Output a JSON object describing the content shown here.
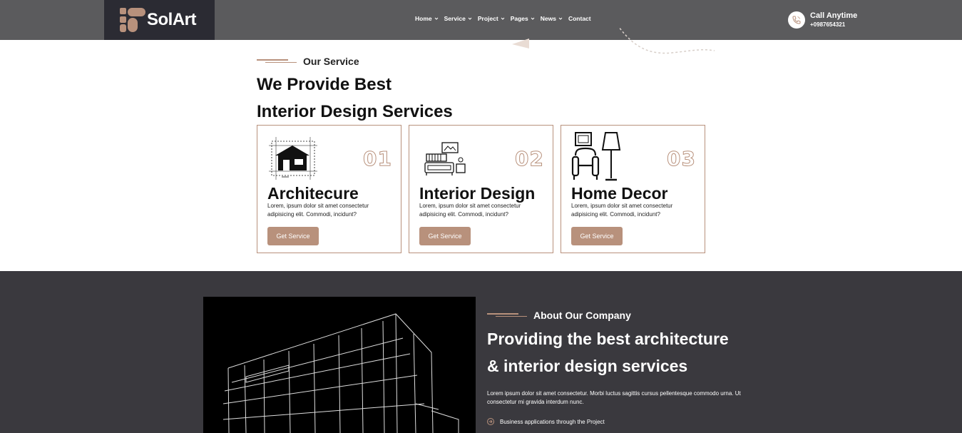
{
  "brand": {
    "name": "SolArt",
    "accent": "#b8917c",
    "header_bg": "#5b5b5d",
    "logo_bg": "#2b2b33"
  },
  "nav": {
    "items": [
      {
        "label": "Home",
        "has_dropdown": true
      },
      {
        "label": "Service",
        "has_dropdown": true
      },
      {
        "label": "Project",
        "has_dropdown": true
      },
      {
        "label": "Pages",
        "has_dropdown": true
      },
      {
        "label": "News",
        "has_dropdown": true
      },
      {
        "label": "Contact",
        "has_dropdown": false
      }
    ]
  },
  "call": {
    "label": "Call Anytime",
    "number": "+0987654321",
    "icon": "phone-icon"
  },
  "services": {
    "tag": "Our Service",
    "title_line1": "We Provide Best",
    "title_line2": "Interior Design Services",
    "cards": [
      {
        "number": "01",
        "title": "Architecure",
        "desc": "Lorem, ipsum dolor sit amet consectetur adipisicing elit. Commodi, incidunt?",
        "button": "Get Service",
        "icon": "house-blueprint-icon"
      },
      {
        "number": "02",
        "title": "Interior Design",
        "desc": "Lorem, ipsum dolor sit amet consectetur adipisicing elit. Commodi, incidunt?",
        "button": "Get Service",
        "icon": "living-room-icon"
      },
      {
        "number": "03",
        "title": "Home Decor",
        "desc": "Lorem, ipsum dolor sit amet consectetur adipisicing elit. Commodi, incidunt?",
        "button": "Get Service",
        "icon": "armchair-lamp-icon"
      }
    ]
  },
  "about": {
    "tag": "About Our Company",
    "title_line1": "Providing the best architecture",
    "title_line2": "& interior design services",
    "desc": "Lorem ipsum dolor sit amet consectetur. Morbi luctus sagittis cursus pellentesque commodo urna. Ut consectetur mi gravida interdum nunc.",
    "bullets": [
      "Business applications through the Project"
    ],
    "bg": "#3a393e"
  }
}
